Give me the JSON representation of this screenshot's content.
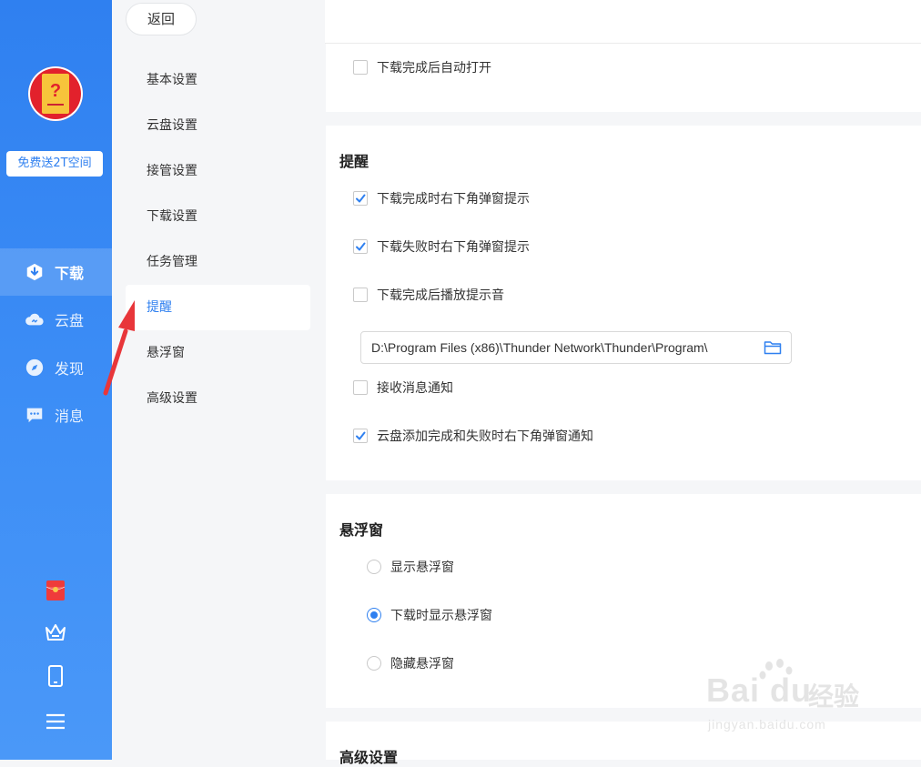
{
  "sidebar": {
    "promo": "免费送2T空间",
    "nav": [
      {
        "label": "下载",
        "icon": "download-icon",
        "active": true
      },
      {
        "label": "云盘",
        "icon": "cloud-icon",
        "active": false
      },
      {
        "label": "发现",
        "icon": "compass-icon",
        "active": false
      },
      {
        "label": "消息",
        "icon": "message-icon",
        "active": false
      }
    ],
    "bottom_icons": [
      "red-envelope-icon",
      "crown-icon",
      "phone-icon",
      "menu-icon"
    ]
  },
  "settings_menu": {
    "back": "返回",
    "items": [
      "基本设置",
      "云盘设置",
      "接管设置",
      "下载设置",
      "任务管理",
      "提醒",
      "悬浮窗",
      "高级设置"
    ],
    "active_index": 5
  },
  "content": {
    "top_option": {
      "label": "下载完成后自动打开",
      "checked": false
    },
    "reminder": {
      "title": "提醒",
      "options": [
        {
          "label": "下载完成时右下角弹窗提示",
          "checked": true
        },
        {
          "label": "下载失败时右下角弹窗提示",
          "checked": true
        },
        {
          "label": "下载完成后播放提示音",
          "checked": false
        },
        {
          "label": "接收消息通知",
          "checked": false
        },
        {
          "label": "云盘添加完成和失败时右下角弹窗通知",
          "checked": true
        }
      ],
      "sound_path": "D:\\Program Files (x86)\\Thunder Network\\Thunder\\Program\\"
    },
    "floating": {
      "title": "悬浮窗",
      "options": [
        {
          "label": "显示悬浮窗",
          "selected": false
        },
        {
          "label": "下载时显示悬浮窗",
          "selected": true
        },
        {
          "label": "隐藏悬浮窗",
          "selected": false
        }
      ]
    },
    "advanced": {
      "title": "高级设置"
    }
  },
  "watermark": {
    "main": "Bai du",
    "cn": "经验",
    "sub": "jingyan.baidu.com"
  },
  "colors": {
    "accent": "#2f80f0",
    "annotation_arrow": "#e8363a"
  }
}
